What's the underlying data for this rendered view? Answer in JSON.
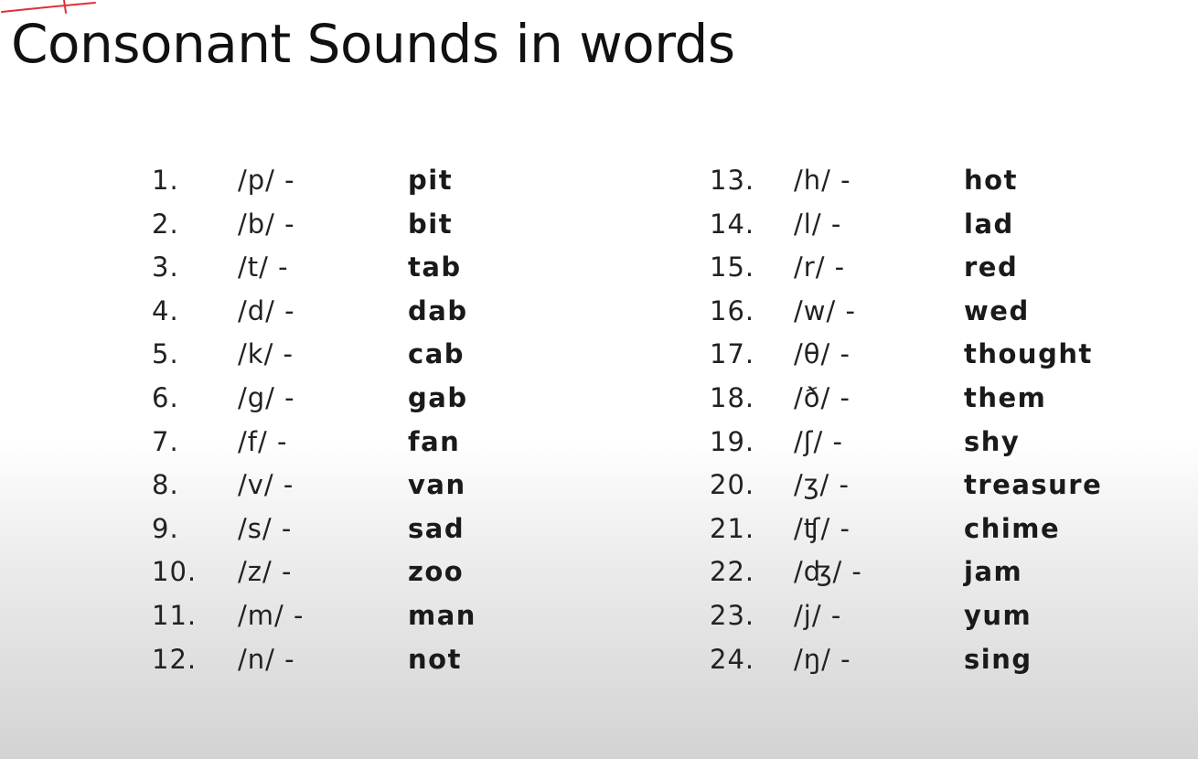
{
  "title": "Consonant Sounds in words",
  "left_column": [
    {
      "num": "1.",
      "ipa": "/p/ -",
      "word": "pit"
    },
    {
      "num": "2.",
      "ipa": "/b/ -",
      "word": "bit"
    },
    {
      "num": "3.",
      "ipa": "/t/ -",
      "word": "tab"
    },
    {
      "num": "4.",
      "ipa": "/d/ -",
      "word": "dab"
    },
    {
      "num": "5.",
      "ipa": "/k/ -",
      "word": "cab"
    },
    {
      "num": "6.",
      "ipa": "/g/ -",
      "word": "gab"
    },
    {
      "num": "7.",
      "ipa": "/f/ -",
      "word": "fan"
    },
    {
      "num": "8.",
      "ipa": "/v/ -",
      "word": "van"
    },
    {
      "num": "9.",
      "ipa": "/s/ -",
      "word": "sad"
    },
    {
      "num": "10.",
      "ipa": "/z/ -",
      "word": "zoo"
    },
    {
      "num": "11.",
      "ipa": "/m/ -",
      "word": "man"
    },
    {
      "num": "12.",
      "ipa": "/n/ -",
      "word": "not"
    }
  ],
  "right_column": [
    {
      "num": "13.",
      "ipa": "/h/ -",
      "word": "hot"
    },
    {
      "num": "14.",
      "ipa": "/l/ -",
      "word": "lad"
    },
    {
      "num": "15.",
      "ipa": "/r/ -",
      "word": "red"
    },
    {
      "num": "16.",
      "ipa": "/w/ -",
      "word": "wed"
    },
    {
      "num": "17.",
      "ipa": "/θ/ -",
      "word": "thought"
    },
    {
      "num": "18.",
      "ipa": "/ð/ -",
      "word": "them"
    },
    {
      "num": "19.",
      "ipa": "/ʃ/ -",
      "word": "shy"
    },
    {
      "num": "20.",
      "ipa": "/ʒ/ -",
      "word": "treasure"
    },
    {
      "num": "21.",
      "ipa": "/ʧ/ -",
      "word": "chime"
    },
    {
      "num": "22.",
      "ipa": "/ʤ/ -",
      "word": "jam"
    },
    {
      "num": "23.",
      "ipa": "/j/ -",
      "word": "yum"
    },
    {
      "num": "24.",
      "ipa": "/ŋ/ -",
      "word": "sing"
    }
  ],
  "colors": {
    "text": "#111111",
    "annotation": "#e0303a"
  }
}
